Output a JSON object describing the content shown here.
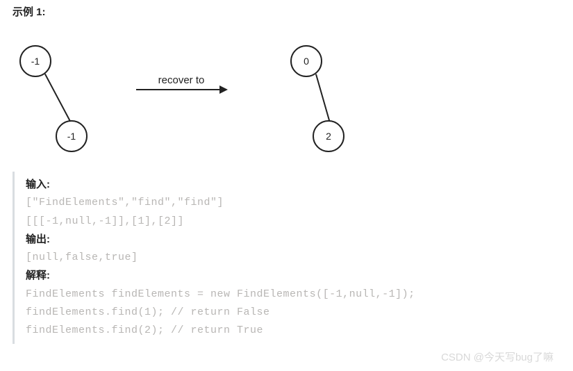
{
  "heading": "示例 1:",
  "diagram": {
    "leftTree": {
      "root": "-1",
      "rightChild": "-1"
    },
    "arrowLabel": "recover to",
    "rightTree": {
      "root": "0",
      "rightChild": "2"
    }
  },
  "labels": {
    "input": "输入:",
    "output": "输出:",
    "explain": "解释:"
  },
  "code": {
    "inputLine1": "[\"FindElements\",\"find\",\"find\"]",
    "inputLine2": "[[[-1,null,-1]],[1],[2]]",
    "outputLine": "[null,false,true]",
    "explainLine1": "FindElements findElements = new FindElements([-1,null,-1]);",
    "explainLine2": "findElements.find(1); // return False",
    "explainLine3": "findElements.find(2); // return True"
  },
  "watermark": "CSDN @今天写bug了嘛"
}
